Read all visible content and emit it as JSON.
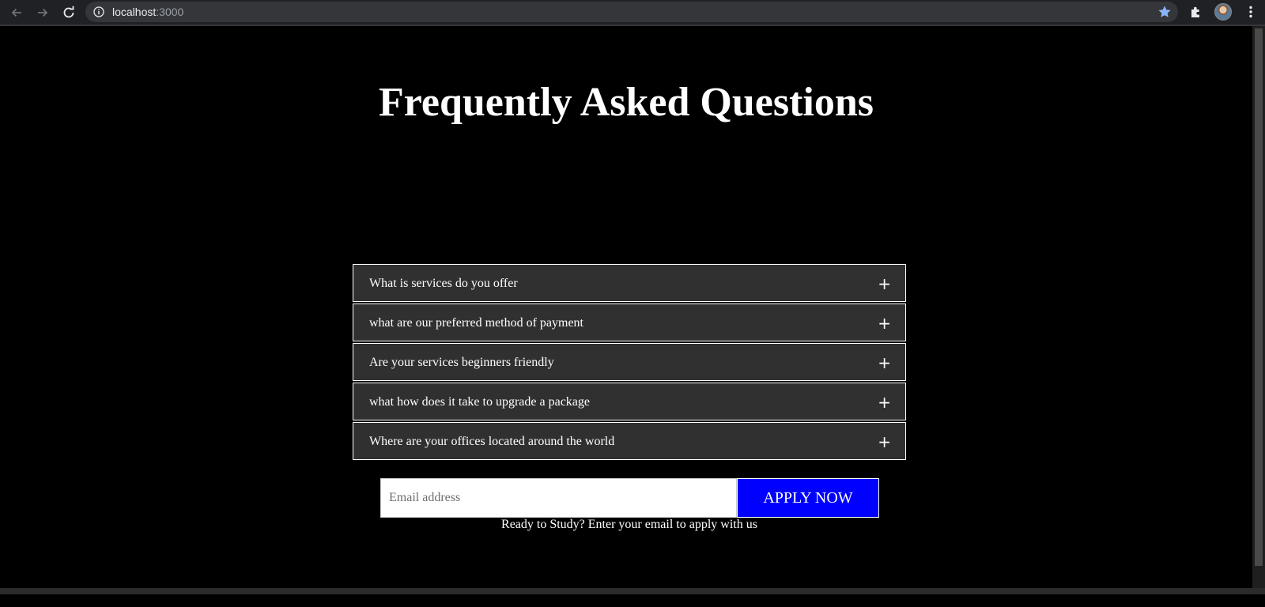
{
  "browser": {
    "url_host": "localhost",
    "url_port": ":3000",
    "icons": {
      "back": "back-arrow-icon",
      "forward": "forward-arrow-icon",
      "reload": "reload-icon",
      "info": "info-icon",
      "bookmark": "star-icon",
      "extensions": "puzzle-icon",
      "profile": "avatar",
      "menu": "kebab-menu-icon"
    },
    "accent_color": "#1a73e8"
  },
  "page": {
    "title": "Frequently Asked Questions",
    "faq": {
      "toggle_symbol": "+",
      "items": [
        {
          "question": "What is services do you offer"
        },
        {
          "question": "what are our preferred method of payment"
        },
        {
          "question": "Are your services beginners friendly"
        },
        {
          "question": "what how does it take to upgrade a package"
        },
        {
          "question": "Where are your offices located around the world"
        }
      ]
    },
    "signup": {
      "email_placeholder": "Email address",
      "button_label": "APPLY NOW",
      "note": "Ready to Study? Enter your email to apply with us"
    },
    "colors": {
      "background": "#000000",
      "faq_item_bg": "#303030",
      "button_bg": "#0000ff",
      "text": "#ffffff"
    }
  }
}
